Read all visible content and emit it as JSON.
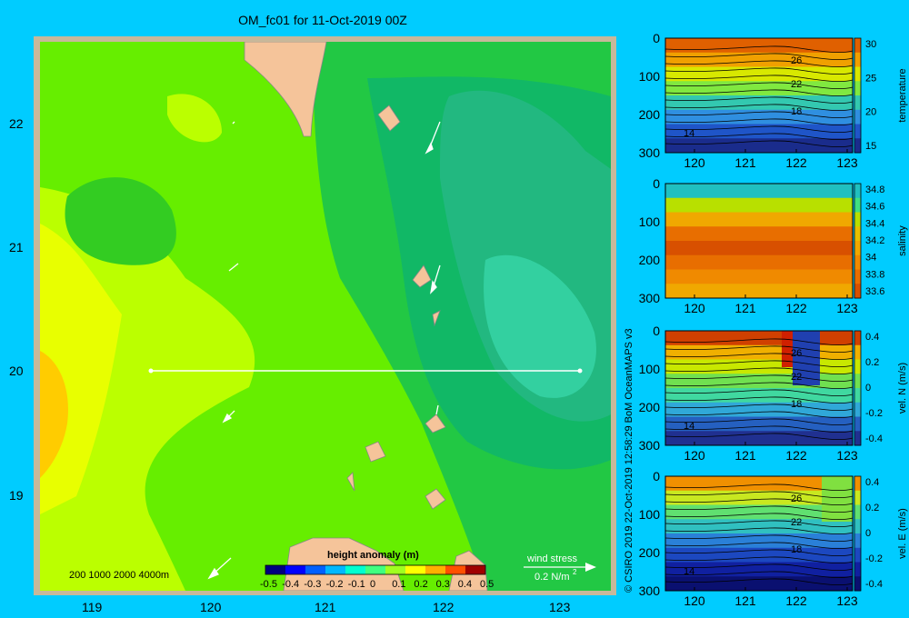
{
  "title": "OM_fc01 for 11-Oct-2019 00Z",
  "copyright": "© CSIRO 2019   22-Oct-2019 12:58:29 BoM OceanMAPS v3",
  "map": {
    "lat_ticks": [
      "22",
      "21",
      "20",
      "19"
    ],
    "lon_ticks": [
      "119",
      "120",
      "121",
      "122",
      "123"
    ],
    "depth_legend": "200  1000  2000  4000m",
    "wind_label": "wind stress",
    "wind_scale": "0.2 N/m",
    "wind_scale_sup": "2",
    "colorbar_title": "height anomaly (m)",
    "colorbar_ticks": [
      "-0.5",
      "-0.4",
      "-0.3",
      "-0.2",
      "-0.1",
      "0",
      "0.1",
      "0.2",
      "0.3",
      "0.4",
      "0.5"
    ],
    "section_line": {
      "lat": 20.0,
      "lon_start": 119.5,
      "lon_end": 123.2
    }
  },
  "colors": {
    "background": "#00ccff",
    "land": "#f5c49a",
    "anomaly_scale": [
      "#00007f",
      "#0000ff",
      "#0060ff",
      "#00b8ff",
      "#00ffd0",
      "#40ff80",
      "#a0ff20",
      "#ffff00",
      "#ffb000",
      "#ff5000",
      "#a00000"
    ]
  },
  "chart_data": [
    {
      "type": "heatmap",
      "title": "",
      "colorbar_label": "temperature",
      "y_ticks": [
        "0",
        "100",
        "200",
        "300"
      ],
      "x_ticks": [
        "120",
        "121",
        "122",
        "123"
      ],
      "colorbar_ticks": [
        "30",
        "25",
        "20",
        "15"
      ],
      "contour_labels": [
        "26",
        "22",
        "18",
        "14"
      ],
      "ylim": [
        300,
        0
      ],
      "xlim": [
        119.5,
        123.2
      ]
    },
    {
      "type": "heatmap",
      "title": "",
      "colorbar_label": "salinity",
      "y_ticks": [
        "0",
        "100",
        "200",
        "300"
      ],
      "x_ticks": [
        "120",
        "121",
        "122",
        "123"
      ],
      "colorbar_ticks": [
        "34.8",
        "34.6",
        "34.4",
        "34.2",
        "34",
        "33.8",
        "33.6"
      ],
      "contour_labels": [],
      "ylim": [
        300,
        0
      ],
      "xlim": [
        119.5,
        123.2
      ]
    },
    {
      "type": "heatmap",
      "title": "",
      "colorbar_label": "vel. N (m/s)",
      "y_ticks": [
        "0",
        "100",
        "200",
        "300"
      ],
      "x_ticks": [
        "120",
        "121",
        "122",
        "123"
      ],
      "colorbar_ticks": [
        "0.4",
        "0.2",
        "0",
        "-0.2",
        "-0.4"
      ],
      "contour_labels": [
        "26",
        "22",
        "18",
        "14"
      ],
      "ylim": [
        300,
        0
      ],
      "xlim": [
        119.5,
        123.2
      ]
    },
    {
      "type": "heatmap",
      "title": "",
      "colorbar_label": "vel. E (m/s)",
      "y_ticks": [
        "0",
        "100",
        "200",
        "300"
      ],
      "x_ticks": [
        "120",
        "121",
        "122",
        "123"
      ],
      "colorbar_ticks": [
        "0.4",
        "0.2",
        "0",
        "-0.2",
        "-0.4"
      ],
      "contour_labels": [
        "26",
        "22",
        "18",
        "14"
      ],
      "ylim": [
        300,
        0
      ],
      "xlim": [
        119.5,
        123.2
      ]
    }
  ]
}
